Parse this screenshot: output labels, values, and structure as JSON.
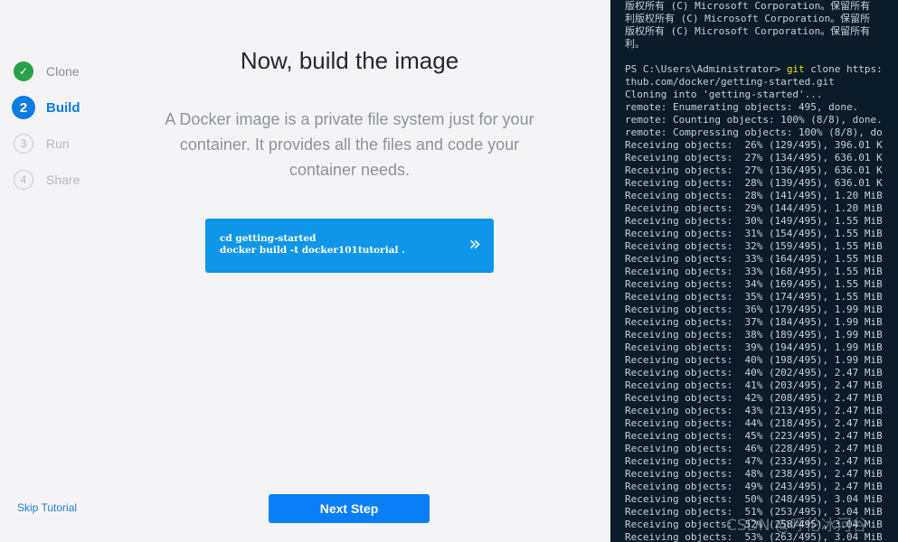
{
  "steps": [
    {
      "number": "✓",
      "label": "Clone",
      "state": "done"
    },
    {
      "number": "2",
      "label": "Build",
      "state": "active"
    },
    {
      "number": "3",
      "label": "Run",
      "state": "pending"
    },
    {
      "number": "4",
      "label": "Share",
      "state": "pending"
    }
  ],
  "main": {
    "title": "Now, build the image",
    "description": "A Docker image is a private file system just for your container. It provides all the files and code your container needs.",
    "command_lines": [
      "cd getting-started",
      "docker build -t docker101tutorial ."
    ],
    "command_arrow": "»"
  },
  "footer": {
    "skip_label": "Skip Tutorial",
    "next_label": "Next Step"
  },
  "terminal": {
    "header_lines": [
      "版权所有 (C) Microsoft Corporation。保留所有",
      "利版权所有 (C) Microsoft Corporation。保留所",
      "版权所有 (C) Microsoft Corporation。保留所有",
      "利。"
    ],
    "prompt": "PS C:\\Users\\Administrator> ",
    "command": "git",
    "command_rest": " clone https:",
    "lines": [
      "thub.com/docker/getting-started.git",
      "Cloning into 'getting-started'...",
      "remote: Enumerating objects: 495, done.",
      "remote: Counting objects: 100% (8/8), done.",
      "remote: Compressing objects: 100% (8/8), do",
      "Receiving objects:  26% (129/495), 396.01 K",
      "Receiving objects:  27% (134/495), 636.01 K",
      "Receiving objects:  27% (136/495), 636.01 K",
      "Receiving objects:  28% (139/495), 636.01 K",
      "Receiving objects:  28% (141/495), 1.20 MiB",
      "Receiving objects:  29% (144/495), 1.20 MiB",
      "Receiving objects:  30% (149/495), 1.55 MiB",
      "Receiving objects:  31% (154/495), 1.55 MiB",
      "Receiving objects:  32% (159/495), 1.55 MiB",
      "Receiving objects:  33% (164/495), 1.55 MiB",
      "Receiving objects:  33% (168/495), 1.55 MiB",
      "Receiving objects:  34% (169/495), 1.55 MiB",
      "Receiving objects:  35% (174/495), 1.55 MiB",
      "Receiving objects:  36% (179/495), 1.99 MiB",
      "Receiving objects:  37% (184/495), 1.99 MiB",
      "Receiving objects:  38% (189/495), 1.99 MiB",
      "Receiving objects:  39% (194/495), 1.99 MiB",
      "Receiving objects:  40% (198/495), 1.99 MiB",
      "Receiving objects:  40% (202/495), 2.47 MiB",
      "Receiving objects:  41% (203/495), 2.47 MiB",
      "Receiving objects:  42% (208/495), 2.47 MiB",
      "Receiving objects:  43% (213/495), 2.47 MiB",
      "Receiving objects:  44% (218/495), 2.47 MiB",
      "Receiving objects:  45% (223/495), 2.47 MiB",
      "Receiving objects:  46% (228/495), 2.47 MiB",
      "Receiving objects:  47% (233/495), 2.47 MiB",
      "Receiving objects:  48% (238/495), 2.47 MiB",
      "Receiving objects:  49% (243/495), 2.47 MiB",
      "Receiving objects:  50% (248/495), 3.04 MiB",
      "Receiving objects:  51% (253/495), 3.04 MiB",
      "Receiving objects:  52% (258/495), 3.04 MiB",
      "Receiving objects:  53% (263/495), 3.04 MiB"
    ],
    "watermark": "CSDN @呼伦冰河谷"
  }
}
